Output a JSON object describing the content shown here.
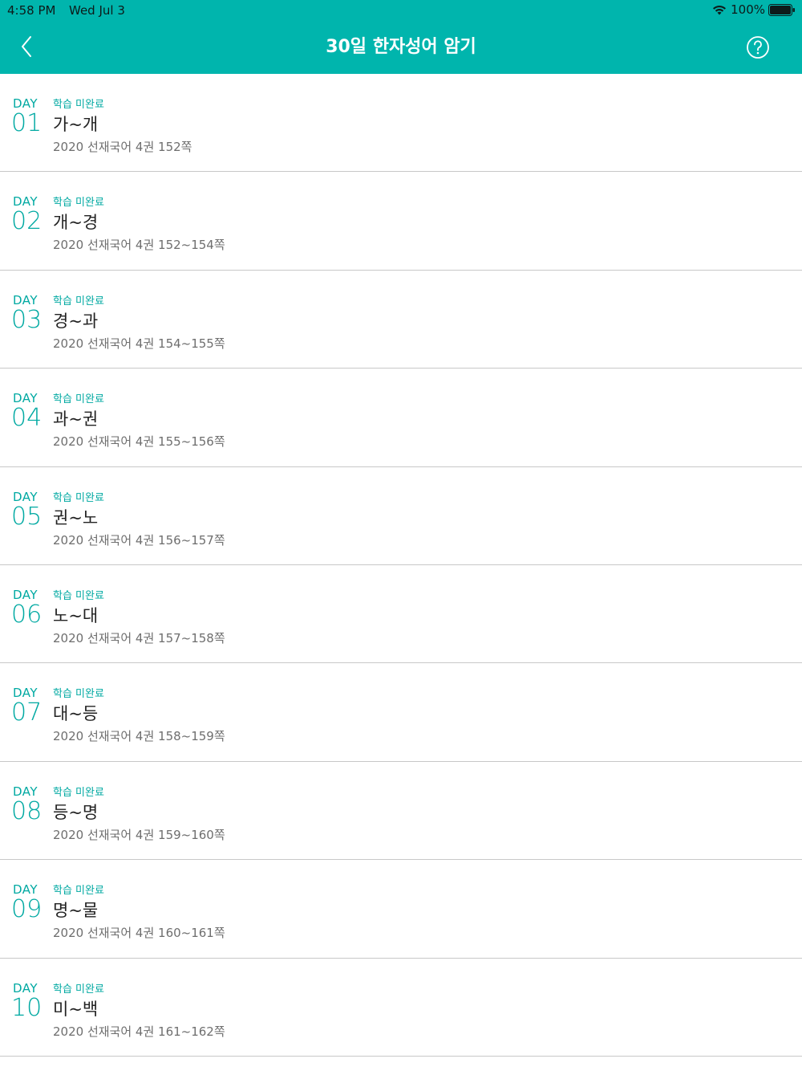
{
  "status_bar": {
    "time": "4:58 PM",
    "date": "Wed Jul 3",
    "battery": "100%"
  },
  "nav": {
    "title": "30일 한자성어 암기",
    "back_icon": "chevron-left-icon",
    "help_icon": "question-circle-icon"
  },
  "colors": {
    "accent": "#00b5ad",
    "accent_text": "#00a9a2"
  },
  "items": [
    {
      "day_label": "DAY",
      "day_num": "01",
      "status": "학습 미완료",
      "range": "가~개",
      "source": "2020 선재국어 4권 152쪽"
    },
    {
      "day_label": "DAY",
      "day_num": "02",
      "status": "학습 미완료",
      "range": "개~경",
      "source": "2020 선재국어 4권 152~154쪽"
    },
    {
      "day_label": "DAY",
      "day_num": "03",
      "status": "학습 미완료",
      "range": "경~과",
      "source": "2020 선재국어 4권 154~155쪽"
    },
    {
      "day_label": "DAY",
      "day_num": "04",
      "status": "학습 미완료",
      "range": "과~권",
      "source": "2020 선재국어 4권 155~156쪽"
    },
    {
      "day_label": "DAY",
      "day_num": "05",
      "status": "학습 미완료",
      "range": "권~노",
      "source": "2020 선재국어 4권 156~157쪽"
    },
    {
      "day_label": "DAY",
      "day_num": "06",
      "status": "학습 미완료",
      "range": "노~대",
      "source": "2020 선재국어 4권 157~158쪽"
    },
    {
      "day_label": "DAY",
      "day_num": "07",
      "status": "학습 미완료",
      "range": "대~등",
      "source": "2020 선재국어 4권 158~159쪽"
    },
    {
      "day_label": "DAY",
      "day_num": "08",
      "status": "학습 미완료",
      "range": "등~명",
      "source": "2020 선재국어 4권 159~160쪽"
    },
    {
      "day_label": "DAY",
      "day_num": "09",
      "status": "학습 미완료",
      "range": "명~물",
      "source": "2020 선재국어 4권 160~161쪽"
    },
    {
      "day_label": "DAY",
      "day_num": "10",
      "status": "학습 미완료",
      "range": "미~백",
      "source": "2020 선재국어 4권 161~162쪽"
    }
  ]
}
